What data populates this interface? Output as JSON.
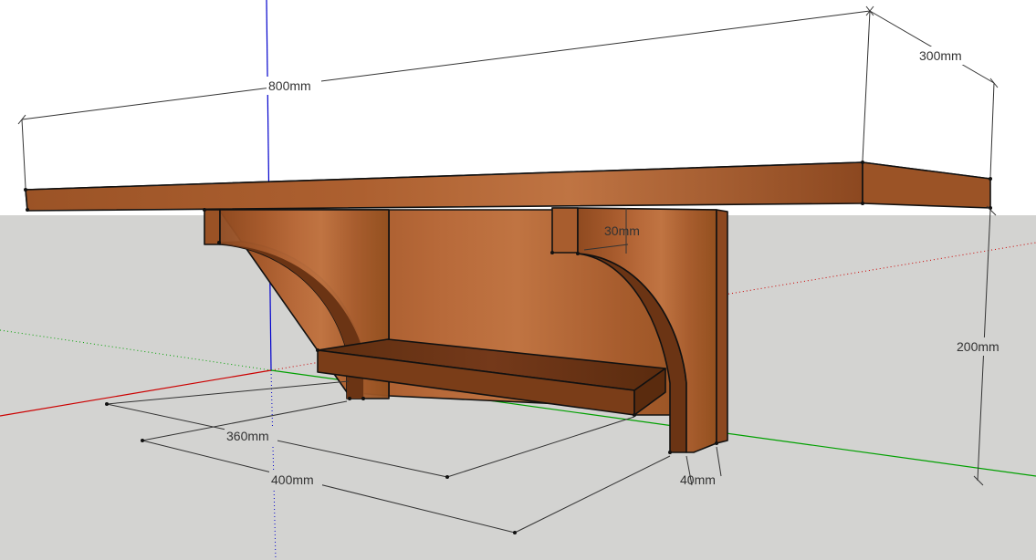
{
  "dimensions": {
    "width_label": "800mm",
    "depth_label": "300mm",
    "height_label": "200mm",
    "notch_label": "30mm",
    "shelf_depth_label": "360mm",
    "bracket_depth_label": "400mm",
    "bracket_thickness_label": "40mm"
  },
  "colors": {
    "sky": "#ffffff",
    "ground": "#d3d3d1",
    "wood_light": "#b5673a",
    "wood_mid": "#9a5225",
    "wood_dark": "#6b3414",
    "red_axis": "#cc0000",
    "green_axis": "#00a000",
    "blue_axis": "#0000cc"
  }
}
